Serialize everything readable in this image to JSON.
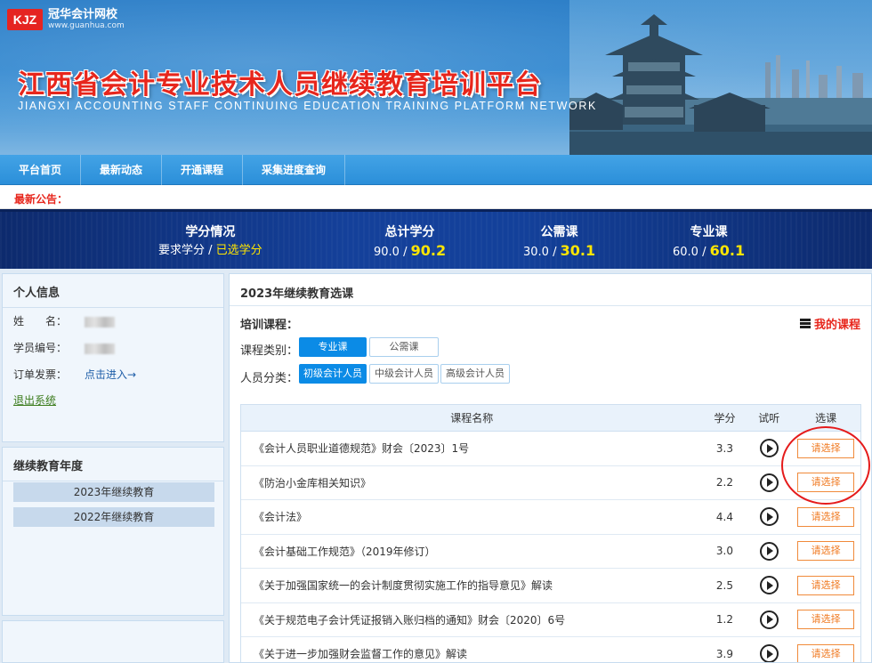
{
  "logo": {
    "mark": "KJZ",
    "name": "冠华会计网校",
    "url": "www.guanhua.com"
  },
  "banner": {
    "title": "江西省会计专业技术人员继续教育培训平台",
    "subtitle": "JIANGXI ACCOUNTING STAFF CONTINUING EDUCATION TRAINING PLATFORM NETWORK"
  },
  "nav": [
    "平台首页",
    "最新动态",
    "开通课程",
    "采集进度查询"
  ],
  "notice": {
    "label": "最新公告："
  },
  "stats": {
    "credits": {
      "title": "学分情况",
      "required_label": "要求学分",
      "sep": " / ",
      "selected_label": "已选学分"
    },
    "total": {
      "title": "总计学分",
      "required": "90.0",
      "selected": "90.2"
    },
    "public": {
      "title": "公需课",
      "required": "30.0",
      "selected": "30.1"
    },
    "professional": {
      "title": "专业课",
      "required": "60.0",
      "selected": "60.1"
    }
  },
  "personal": {
    "title": "个人信息",
    "name_label": "姓　　名：",
    "id_label": "学员编号：",
    "invoice_label": "订单发票：",
    "invoice_link": "点击进入→",
    "logout": "退出系统"
  },
  "years": {
    "title": "继续教育年度",
    "items": [
      "2023年继续教育",
      "2022年继续教育"
    ]
  },
  "main": {
    "title": "2023年继续教育选课",
    "training_label": "培训课程：",
    "my_courses": "我的课程",
    "category_label": "课程类别：",
    "categories": [
      "专业课",
      "公需课"
    ],
    "staff_label": "人员分类：",
    "staff_types": [
      "初级会计人员",
      "中级会计人员",
      "高级会计人员"
    ],
    "columns": {
      "name": "课程名称",
      "credit": "学分",
      "trial": "试听",
      "select": "选课"
    },
    "select_label": "请选择",
    "rows": [
      {
        "name": "《会计人员职业道德规范》财会〔2023〕1号",
        "credit": "3.3"
      },
      {
        "name": "《防治小金库相关知识》",
        "credit": "2.2"
      },
      {
        "name": "《会计法》",
        "credit": "4.4"
      },
      {
        "name": "《会计基础工作规范》（2019年修订）",
        "credit": "3.0"
      },
      {
        "name": "《关于加强国家统一的会计制度贯彻实施工作的指导意见》解读",
        "credit": "2.5"
      },
      {
        "name": "《关于规范电子会计凭证报销入账归档的通知》财会〔2020〕6号",
        "credit": "1.2"
      },
      {
        "name": "《关于进一步加强财会监督工作的意见》解读",
        "credit": "3.9"
      }
    ]
  },
  "colors": {
    "accent": "#0b8be6",
    "title_red": "#e7261c",
    "select_orange": "#f07a22"
  }
}
